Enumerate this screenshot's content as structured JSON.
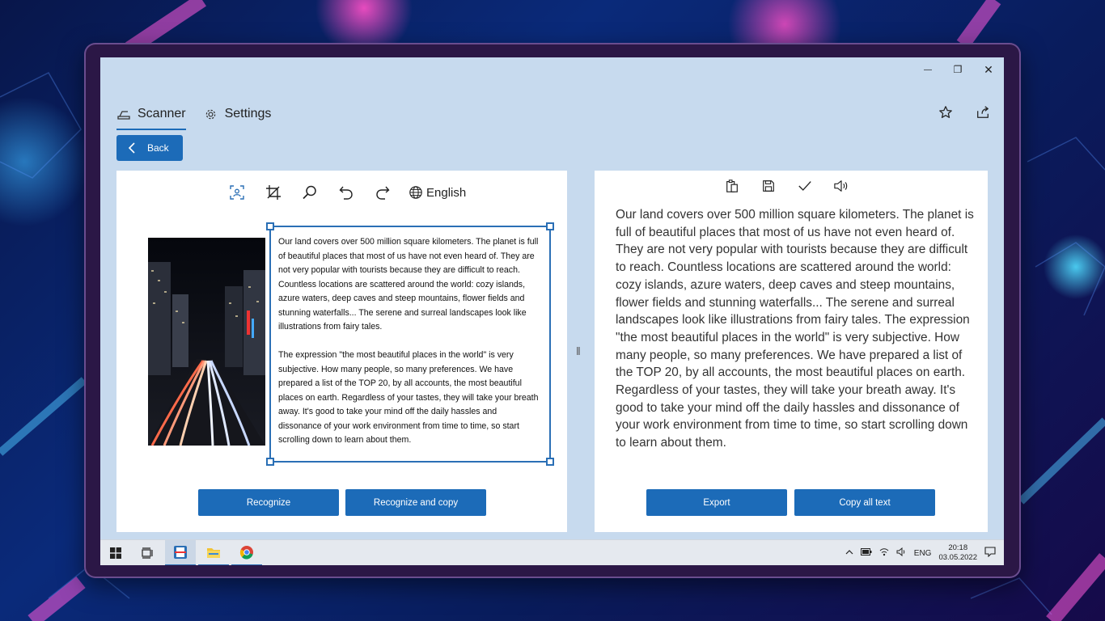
{
  "window": {
    "minimize_glyph": "—",
    "maximize_glyph": "❐",
    "close_glyph": "✕"
  },
  "nav": {
    "tabs": [
      {
        "label": "Scanner",
        "icon": "scanner-icon",
        "active": true
      },
      {
        "label": "Settings",
        "icon": "gear-icon",
        "active": false
      }
    ],
    "back_label": "Back"
  },
  "scanner": {
    "language": "English",
    "paragraphs": [
      "Our land covers over 500 million square kilometers. The planet is full of beautiful places that most of us have not even heard of. They are not very popular with tourists because they are difficult to reach. Countless locations are scattered around the world: cozy islands, azure waters, deep caves and steep mountains, flower fields and stunning waterfalls... The serene and surreal landscapes look like illustrations from fairy tales.",
      "The expression \"the most beautiful places in the world\" is very subjective. How many people, so many preferences. We have prepared a list of the TOP 20, by all accounts, the most beautiful places on earth. Regardless of your tastes, they will take your breath away. It's good to take your mind off the daily hassles and dissonance of your work environment from time to time, so start scrolling down to learn about them."
    ],
    "recognize_label": "Recognize",
    "recognize_copy_label": "Recognize and copy"
  },
  "result": {
    "text": "Our land covers over 500 million square kilometers. The planet is full of beautiful places that most of us have not even heard of. They are not very popular with tourists because they are difficult to reach. Countless locations are scattered around the world: cozy islands, azure waters, deep caves and steep mountains, flower fields and stunning waterfalls... The serene and surreal landscapes look like illustrations from fairy tales. The expression \"the most beautiful places in the world\" is very subjective. How many people, so many preferences. We have prepared a list of the TOP 20, by all accounts, the most beautiful places on earth. Regardless of your tastes, they will take your breath away. It's good to take your mind off the daily hassles and dissonance of your work environment from time to time, so start scrolling down to learn about them.",
    "export_label": "Export",
    "copy_all_label": "Copy all text"
  },
  "splitter_glyph": "‖",
  "taskbar": {
    "language": "ENG",
    "time": "20:18",
    "date": "03.05.2022"
  },
  "colors": {
    "accent": "#1c6bb8",
    "window_bg": "#c7daee",
    "panel_bg": "#ffffff"
  }
}
